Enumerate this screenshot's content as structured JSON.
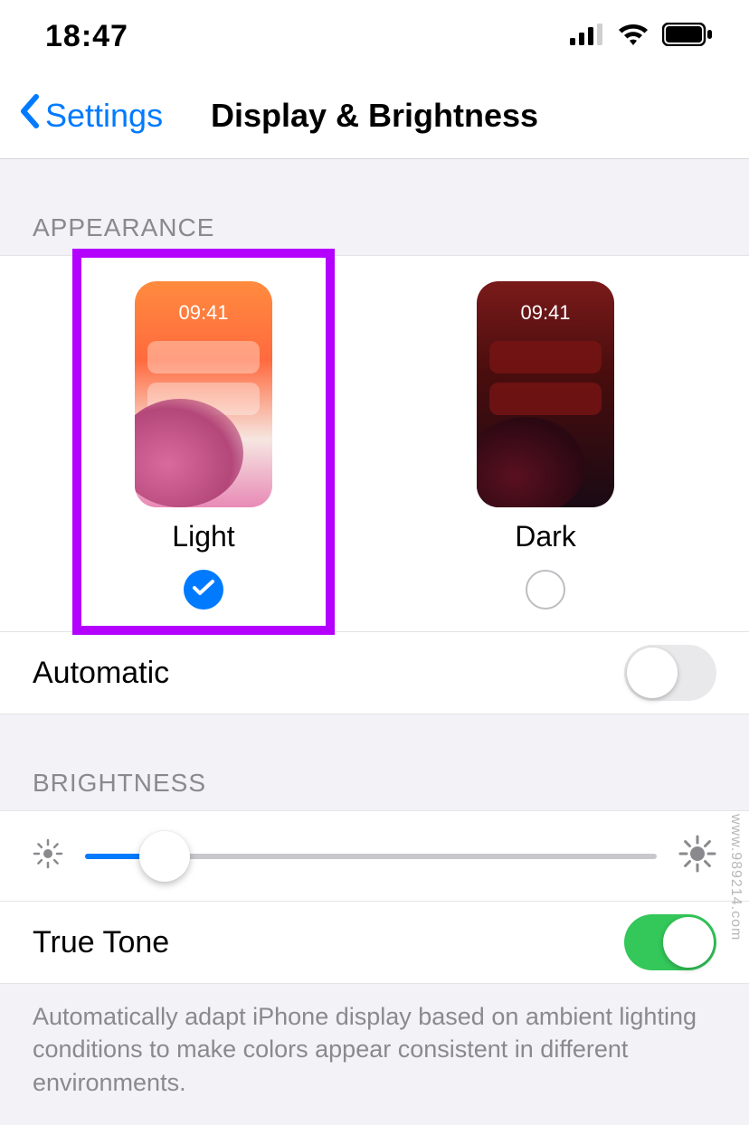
{
  "status": {
    "time": "18:47"
  },
  "nav": {
    "back_label": "Settings",
    "title": "Display & Brightness"
  },
  "appearance": {
    "header": "APPEARANCE",
    "light_label": "Light",
    "dark_label": "Dark",
    "preview_time": "09:41",
    "selected": "light"
  },
  "automatic": {
    "label": "Automatic",
    "enabled": false
  },
  "brightness": {
    "header": "BRIGHTNESS",
    "value_percent": 14
  },
  "true_tone": {
    "label": "True Tone",
    "enabled": true,
    "footer": "Automatically adapt iPhone display based on ambient lighting conditions to make colors appear consistent in different environments."
  },
  "watermark": "www.989214.com",
  "colors": {
    "accent": "#007aff",
    "toggle_on": "#34c759",
    "highlight": "#b400ff"
  }
}
